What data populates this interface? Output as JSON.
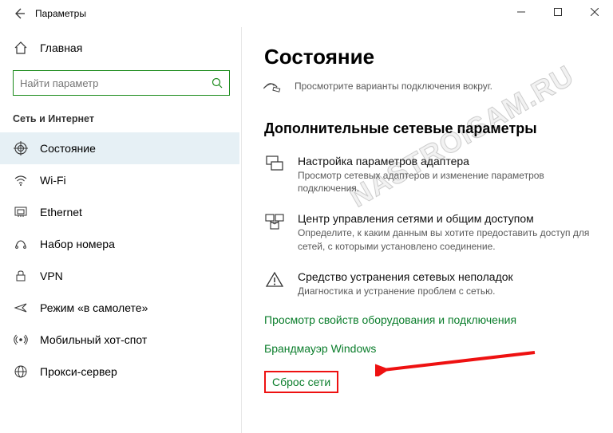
{
  "titlebar": {
    "title": "Параметры"
  },
  "home": {
    "label": "Главная"
  },
  "search": {
    "placeholder": "Найти параметр"
  },
  "sectionLabel": "Сеть и Интернет",
  "nav": {
    "items": [
      {
        "label": "Состояние"
      },
      {
        "label": "Wi-Fi"
      },
      {
        "label": "Ethernet"
      },
      {
        "label": "Набор номера"
      },
      {
        "label": "VPN"
      },
      {
        "label": "Режим «в самолете»"
      },
      {
        "label": "Мобильный хот-спот"
      },
      {
        "label": "Прокси-сервер"
      }
    ]
  },
  "page": {
    "heading": "Состояние",
    "scanDesc": "Просмотрите варианты подключения вокруг.",
    "subheading": "Дополнительные сетевые параметры",
    "adapter": {
      "title": "Настройка параметров адаптера",
      "desc": "Просмотр сетевых адаптеров и изменение параметров подключения."
    },
    "sharing": {
      "title": "Центр управления сетями и общим доступом",
      "desc": "Определите, к каким данным вы хотите предоставить доступ для сетей, с которыми установлено соединение."
    },
    "trouble": {
      "title": "Средство устранения сетевых неполадок",
      "desc": "Диагностика и устранение проблем с сетью."
    },
    "link1": "Просмотр свойств оборудования и подключения",
    "link2": "Брандмауэр Windows",
    "link3": "Сброс сети"
  },
  "watermark": "NASTROISAM.RU"
}
